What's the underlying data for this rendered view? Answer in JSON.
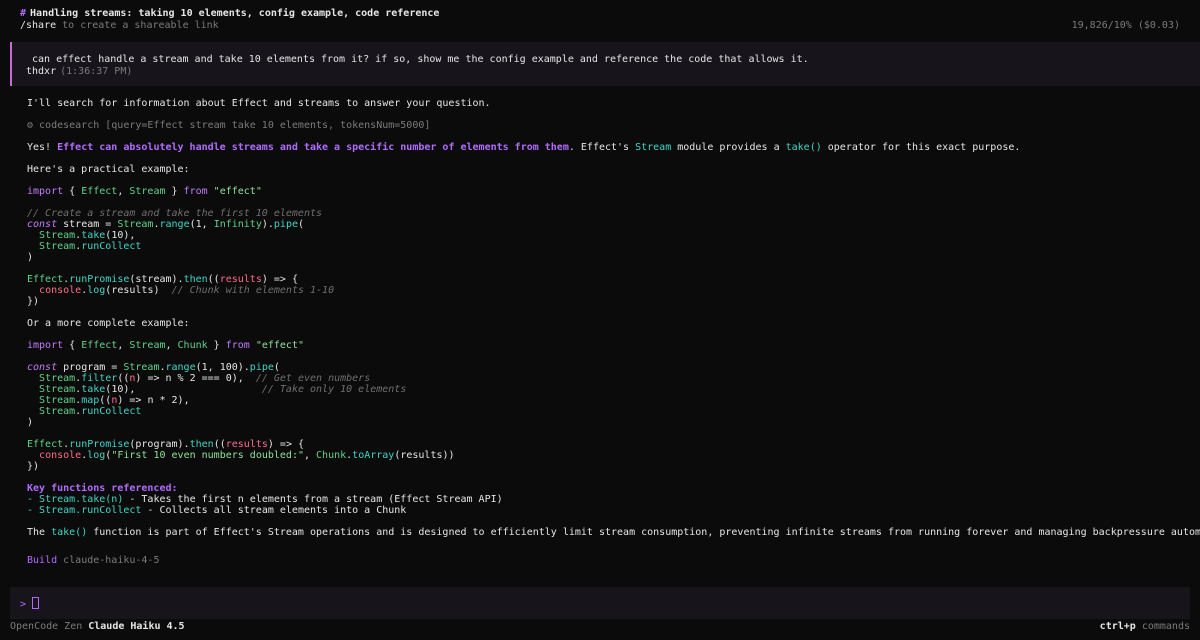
{
  "header": {
    "hash": "#",
    "title": "Handling streams: taking 10 elements, config example, code reference",
    "share_cmd": "/share",
    "share_hint": "to create a shareable link",
    "stats": "19,826/10% ($0.03)"
  },
  "user_message": {
    "text": "can effect handle a stream and take 10 elements from it? if so, show me the config example and reference the code that allows it.",
    "author": "thdxr",
    "time": "(1:36:37 PM)"
  },
  "assistant": {
    "intro": "I'll search for information about Effect and streams to answer your question.",
    "tool_call": "⚙ codesearch [query=Effect stream take 10 elements, tokensNum=5000]",
    "answer_yes": "Yes! ",
    "answer_emph": "Effect can absolutely handle streams and take a specific number of elements from them",
    "answer_after": ". Effect's ",
    "stream_word": "Stream",
    "answer_mid": " module provides a ",
    "take_word": "take()",
    "answer_end": " operator for this exact purpose.",
    "practical": "Here's a practical example:",
    "more_complete": "Or a more complete example:",
    "key_heading": "Key functions referenced:",
    "key_items": [
      {
        "dash": "- ",
        "name": "Stream.take(n)",
        "desc": " - Takes the first n elements from a stream (Effect Stream API)"
      },
      {
        "dash": "- ",
        "name": "Stream.runCollect",
        "desc": " - Collects all stream elements into a Chunk"
      }
    ],
    "closing_pre": "The ",
    "closing_take": "take()",
    "closing_post": " function is part of Effect's Stream operations and is designed to efficiently limit stream consumption, preventing infinite streams from running forever and managing backpressure automatically."
  },
  "build": {
    "label": "Build",
    "model": "claude-haiku-4-5"
  },
  "input": {
    "prompt": ">"
  },
  "footer": {
    "brand": "OpenCode Zen",
    "model": "Claude Haiku 4.5",
    "shortcut": "ctrl+p",
    "shortcut_label": "commands"
  }
}
